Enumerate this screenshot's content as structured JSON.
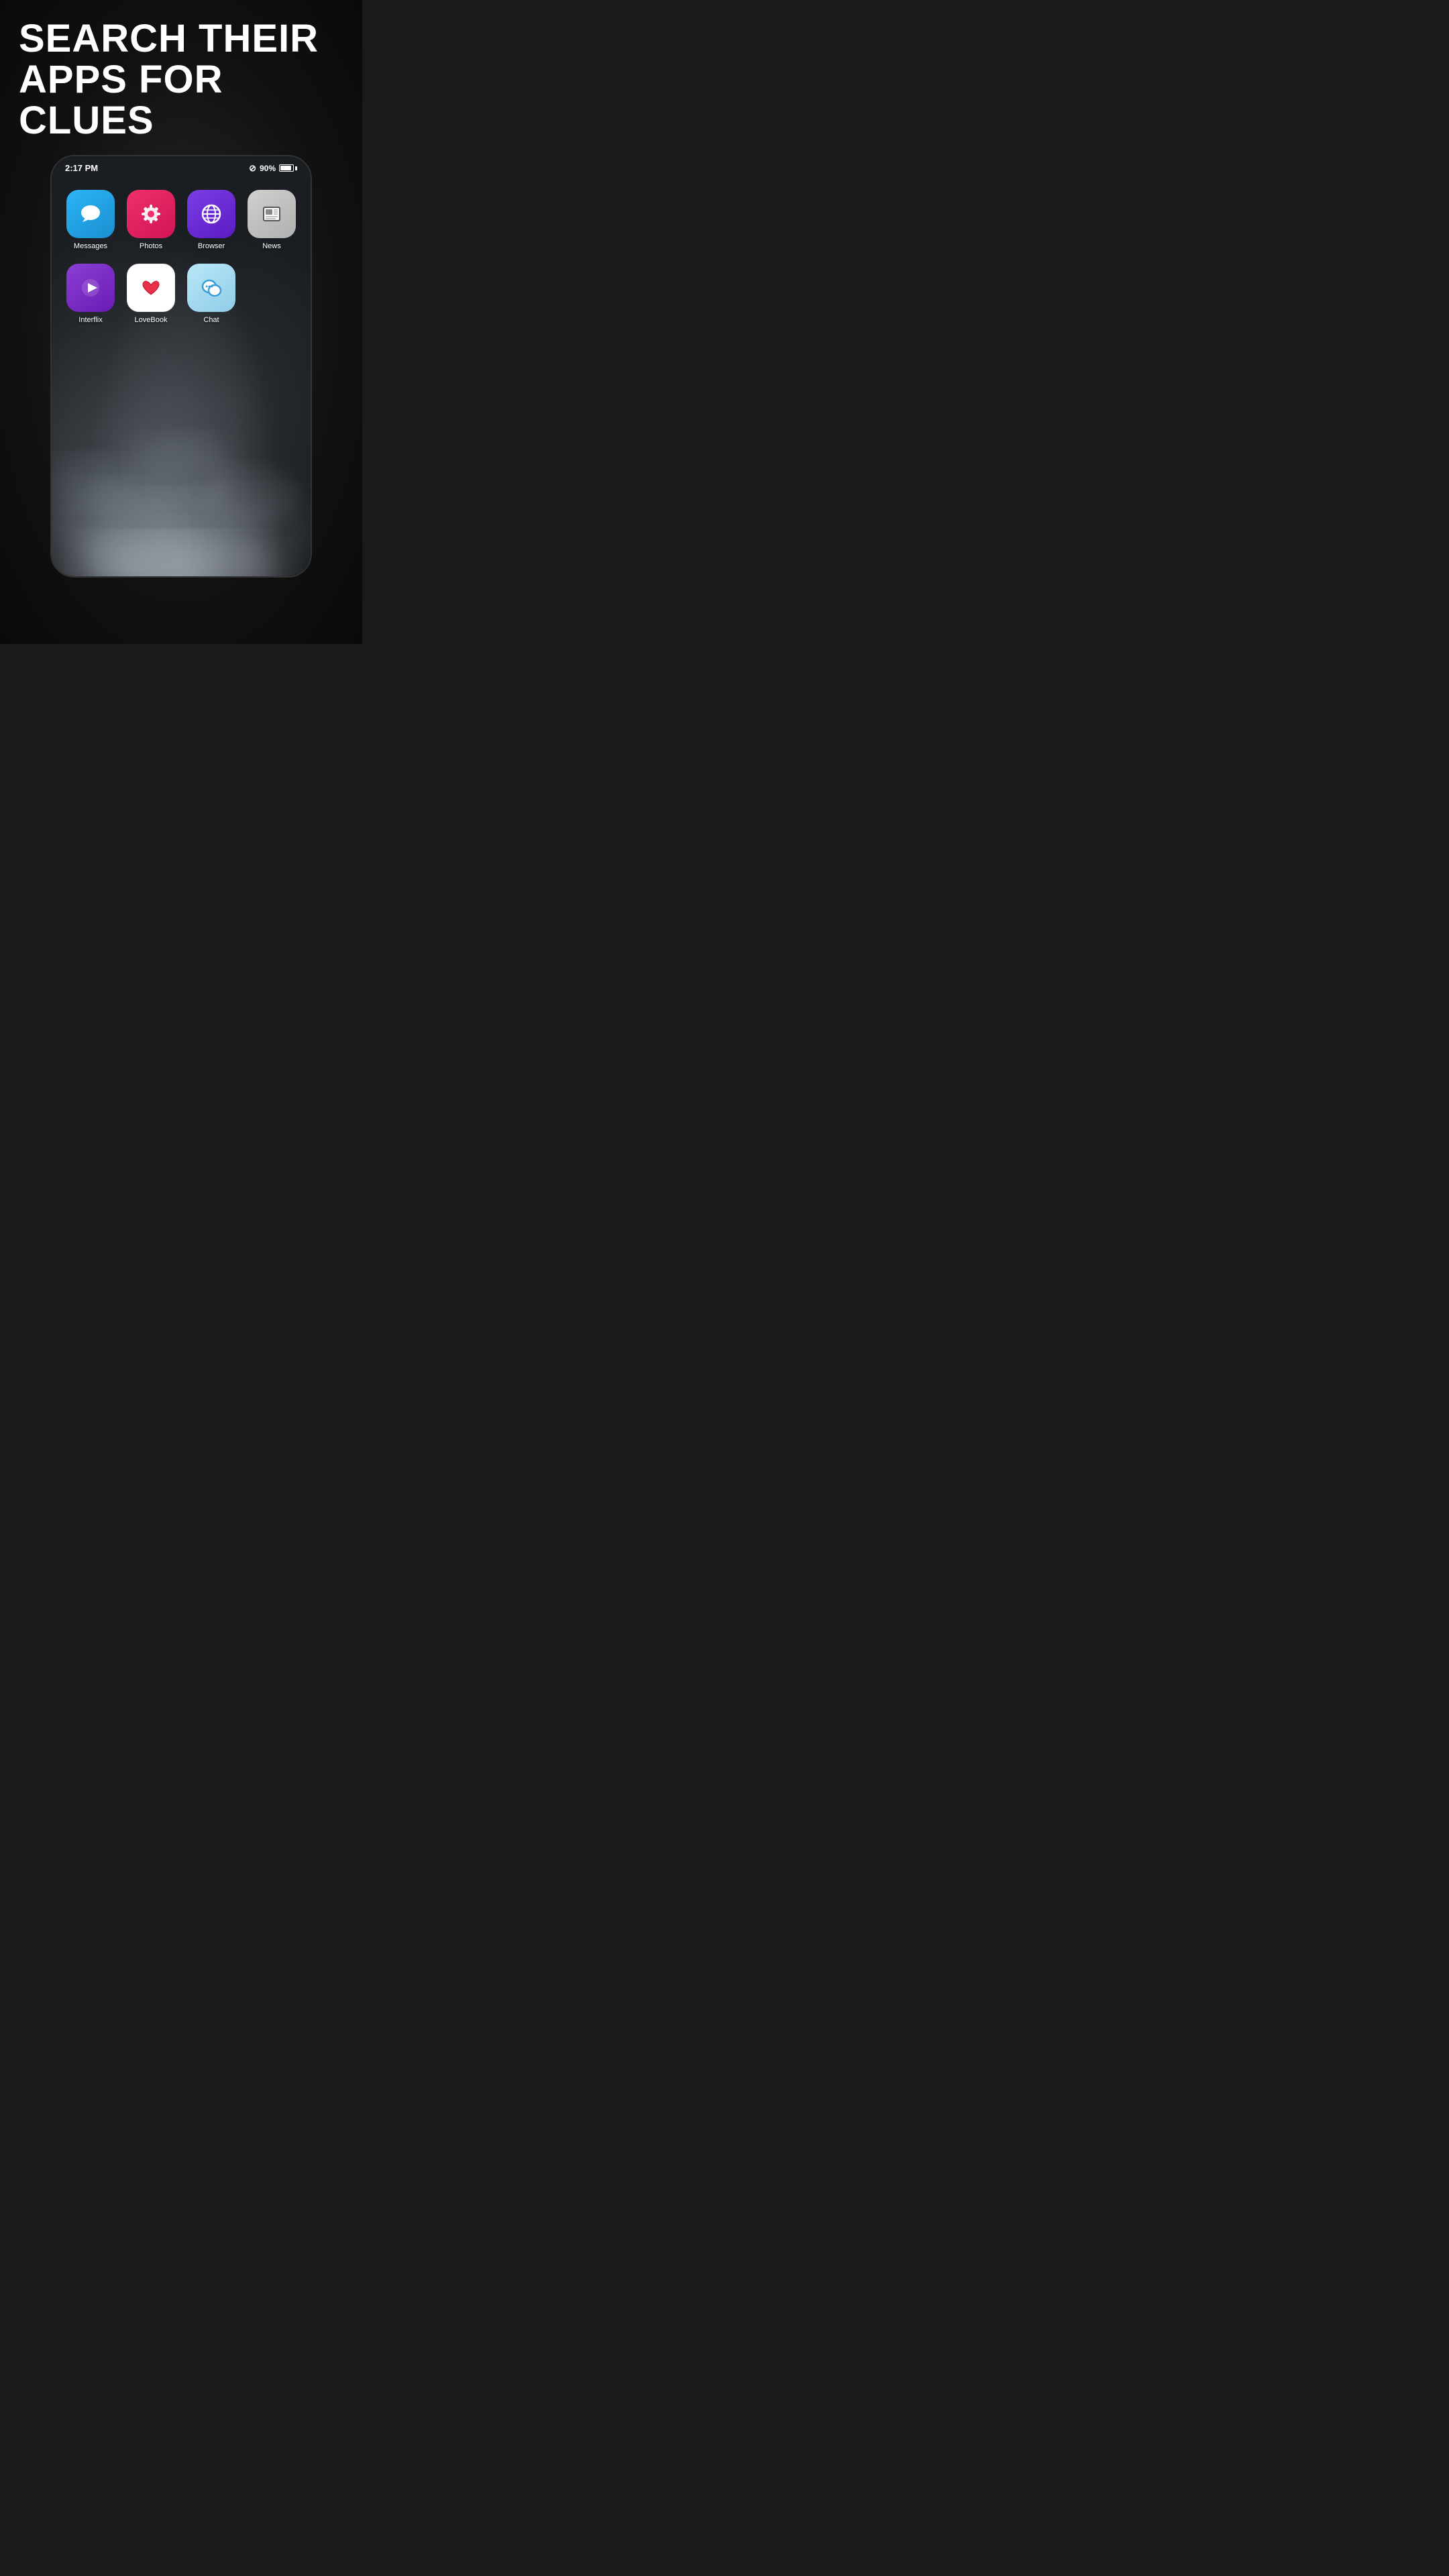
{
  "headline": {
    "line1": "SEARCH THEIR",
    "line2": "APPS FOR CLUES"
  },
  "status_bar": {
    "time": "2:17 PM",
    "battery_percent": "90%",
    "no_disturb_icon": "⊘"
  },
  "apps_row1": [
    {
      "id": "messages",
      "label": "Messages",
      "icon_class": "icon-messages",
      "icon_type": "messages"
    },
    {
      "id": "photos",
      "label": "Photos",
      "icon_class": "icon-photos",
      "icon_type": "photos"
    },
    {
      "id": "browser",
      "label": "Browser",
      "icon_class": "icon-browser",
      "icon_type": "browser"
    },
    {
      "id": "news",
      "label": "News",
      "icon_class": "icon-news",
      "icon_type": "news"
    }
  ],
  "apps_row2": [
    {
      "id": "interflix",
      "label": "Interflix",
      "icon_class": "icon-interflix",
      "icon_type": "interflix"
    },
    {
      "id": "lovebook",
      "label": "LoveBook",
      "icon_class": "icon-lovebook",
      "icon_type": "lovebook"
    },
    {
      "id": "chat",
      "label": "Chat",
      "icon_class": "icon-chat",
      "icon_type": "chat"
    }
  ]
}
